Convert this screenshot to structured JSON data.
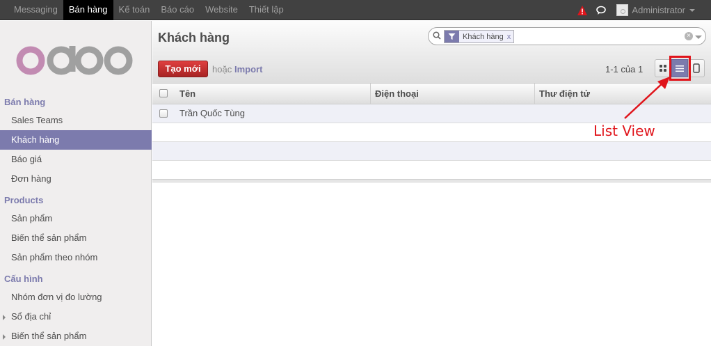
{
  "topbar": {
    "items": [
      {
        "label": "Messaging",
        "active": false
      },
      {
        "label": "Bán hàng",
        "active": true
      },
      {
        "label": "Kế toán",
        "active": false
      },
      {
        "label": "Báo cáo",
        "active": false
      },
      {
        "label": "Website",
        "active": false
      },
      {
        "label": "Thiết lập",
        "active": false
      }
    ],
    "user": "Administrator"
  },
  "sidebar": {
    "logo_text": "odoo",
    "sections": [
      {
        "title": "Bán hàng",
        "items": [
          "Sales Teams",
          "Khách hàng",
          "Báo giá",
          "Đơn hàng"
        ]
      },
      {
        "title": "Products",
        "items": [
          "Sản phẩm",
          "Biến thể sản phẩm",
          "Sản phẩm theo nhóm"
        ]
      },
      {
        "title": "Cấu hình",
        "items": [
          "Nhóm đơn vị đo lường",
          "Sổ địa chỉ",
          "Biến thể sản phẩm"
        ]
      }
    ],
    "active_item": "Khách hàng"
  },
  "control_panel": {
    "title": "Khách hàng",
    "search_facet": "Khách hàng",
    "search_facet_remove": "x",
    "create_label": "Tạo mới",
    "or_label": "hoặc",
    "import_label": "Import",
    "pager": "1-1 của 1",
    "active_view": "list"
  },
  "table": {
    "columns": [
      "Tên",
      "Điện thoại",
      "Thư điện tử"
    ],
    "rows": [
      {
        "name": "Trần Quốc Tùng",
        "phone": "",
        "email": ""
      }
    ]
  },
  "annotation": {
    "label": "List View",
    "color": "#e0141b"
  },
  "colors": {
    "accent": "#7c7bad",
    "topbar": "#414141",
    "create_button": "#c53030"
  }
}
